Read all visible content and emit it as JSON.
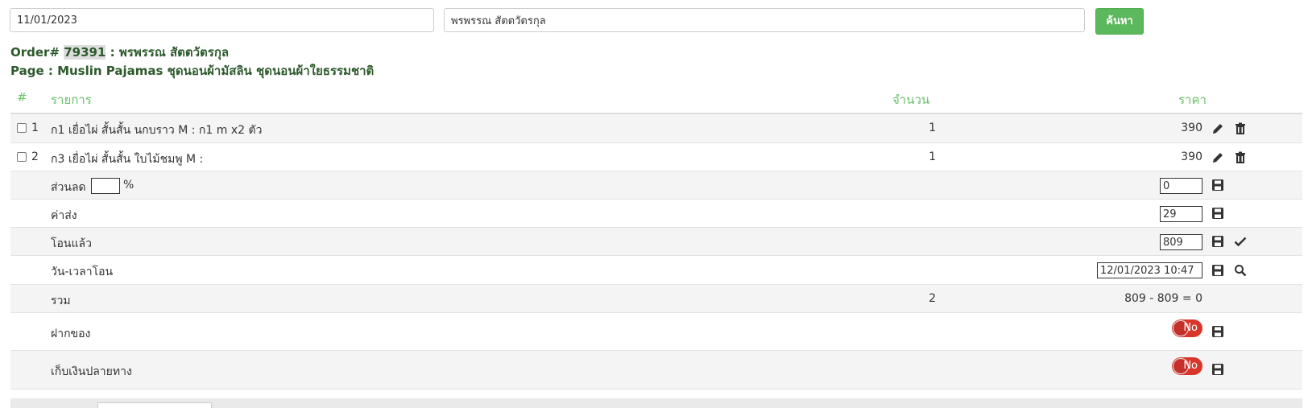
{
  "search": {
    "date_value": "11/01/2023",
    "name_value": "พรพรรณ สัตตวัตรกุล",
    "button_label": "ค้นหา"
  },
  "order": {
    "prefix": "Order# ",
    "number": "79391",
    "customer": " : พรพรรณ สัตตวัตรกุล",
    "page_line": "Page : Muslin Pajamas ชุดนอนผ้ามัสลิน ชุดนอนผ้าใยธรรมชาติ"
  },
  "table": {
    "headers": {
      "index": "#",
      "item": "รายการ",
      "qty": "จำนวน",
      "price": "ราคา"
    },
    "items": [
      {
        "index": "1",
        "name": "ก1 เยื่อไผ่ สั้นสั้น นกบราว M : ก1 m x2 ตัว",
        "qty": "1",
        "price": "390"
      },
      {
        "index": "2",
        "name": "ก3 เยื่อไผ่ สั้นสั้น ใบไม้ชมพู M :",
        "qty": "1",
        "price": "390"
      }
    ],
    "discount": {
      "label": "ส่วนลด",
      "percent_value": "",
      "percent_sign": "%",
      "value": "0"
    },
    "shipping": {
      "label": "ค่าส่ง",
      "value": "29"
    },
    "transferred": {
      "label": "โอนแล้ว",
      "value": "809"
    },
    "transfer_time": {
      "label": "วัน-เวลาโอน",
      "value": "12/01/2023 10:47"
    },
    "total": {
      "label": "รวม",
      "qty": "2",
      "summary": "809 - 809 = 0"
    },
    "deposit": {
      "label": "ฝากของ",
      "toggle": "No"
    },
    "cod": {
      "label": "เก็บเงินปลายทาง",
      "toggle": "No"
    }
  }
}
